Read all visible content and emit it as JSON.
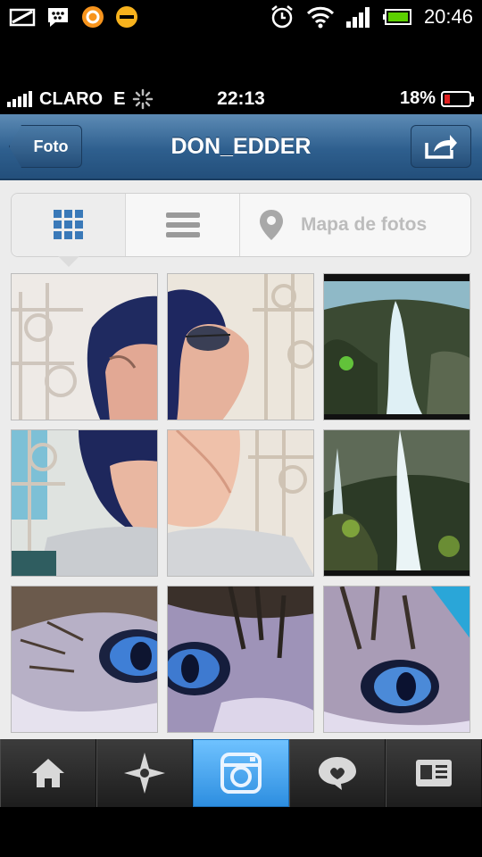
{
  "android_status": {
    "time": "20:46"
  },
  "ios_status": {
    "carrier": "CLARO",
    "network": "E",
    "time": "22:13",
    "battery": "18%"
  },
  "navbar": {
    "back_label": "Foto",
    "title": "DON_EDDER"
  },
  "segments": {
    "map_label": "Mapa de fotos"
  },
  "photos": [
    {
      "name": "selfie-part-1"
    },
    {
      "name": "selfie-part-2"
    },
    {
      "name": "waterfall-part-1"
    },
    {
      "name": "selfie-part-3"
    },
    {
      "name": "selfie-part-4"
    },
    {
      "name": "waterfall-part-2"
    },
    {
      "name": "cat-eye-part-1"
    },
    {
      "name": "cat-eye-part-2"
    },
    {
      "name": "cat-eye-part-3"
    }
  ],
  "tabs": [
    {
      "name": "home-icon"
    },
    {
      "name": "explore-icon"
    },
    {
      "name": "camera-icon"
    },
    {
      "name": "news-icon"
    },
    {
      "name": "profile-icon"
    }
  ],
  "colors": {
    "nav_blue": "#2e5f8e",
    "tab_active": "#2d8ee0",
    "grid_icon": "#3a79b8"
  }
}
